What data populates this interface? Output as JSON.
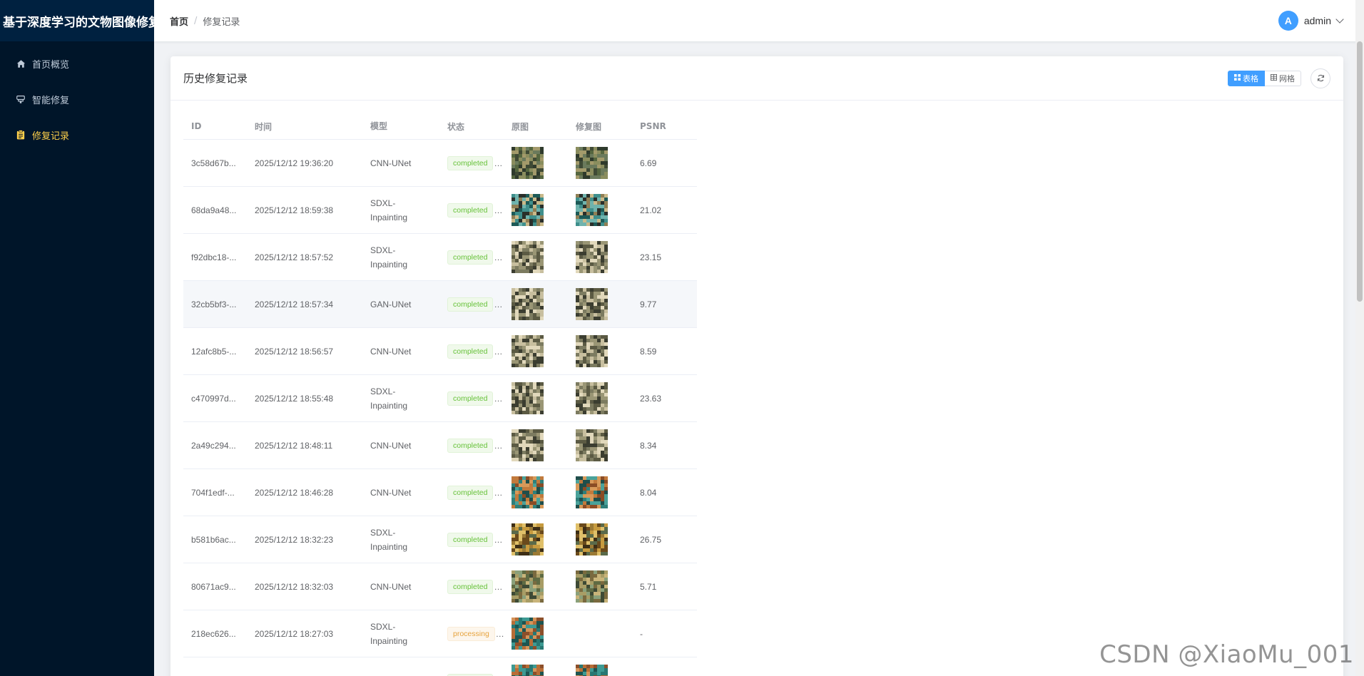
{
  "app": {
    "title": "基于深度学习的文物图像修复"
  },
  "sidebar": {
    "items": [
      {
        "label": "首页概览",
        "icon": "home-icon",
        "active": false
      },
      {
        "label": "智能修复",
        "icon": "brush-icon",
        "active": false
      },
      {
        "label": "修复记录",
        "icon": "clipboard-icon",
        "active": true
      }
    ]
  },
  "header": {
    "breadcrumb": {
      "home": "首页",
      "separator": "/",
      "current": "修复记录"
    },
    "user": {
      "avatar_letter": "A",
      "name": "admin"
    }
  },
  "card": {
    "title": "历史修复记录",
    "view_table_label": "表格",
    "view_grid_label": "网格",
    "refresh_icon": "refresh-icon"
  },
  "table": {
    "columns": [
      "ID",
      "时间",
      "模型",
      "状态",
      "原图",
      "修复图",
      "PSNR"
    ],
    "rows": [
      {
        "id": "3c58d67b...",
        "time": "2025/12/12 19:36:20",
        "model": [
          "CNN-UNet"
        ],
        "status": "completed",
        "psnr": "6.69",
        "theme": "dense",
        "restored": true
      },
      {
        "id": "68da9a48...",
        "time": "2025/12/12 18:59:38",
        "model": [
          "SDXL-",
          "Inpainting"
        ],
        "status": "completed",
        "psnr": "21.02",
        "theme": "teal",
        "restored": true
      },
      {
        "id": "f92dbc18-...",
        "time": "2025/12/12 18:57:52",
        "model": [
          "SDXL-",
          "Inpainting"
        ],
        "status": "completed",
        "psnr": "23.15",
        "theme": "pale",
        "restored": true
      },
      {
        "id": "32cb5bf3-...",
        "time": "2025/12/12 18:57:34",
        "model": [
          "GAN-UNet"
        ],
        "status": "completed",
        "psnr": "9.77",
        "theme": "pale",
        "restored": true
      },
      {
        "id": "12afc8b5-...",
        "time": "2025/12/12 18:56:57",
        "model": [
          "CNN-UNet"
        ],
        "status": "completed",
        "psnr": "8.59",
        "theme": "pale",
        "restored": true
      },
      {
        "id": "c470997d...",
        "time": "2025/12/12 18:55:48",
        "model": [
          "SDXL-",
          "Inpainting"
        ],
        "status": "completed",
        "psnr": "23.63",
        "theme": "pale",
        "restored": true
      },
      {
        "id": "2a49c294...",
        "time": "2025/12/12 18:48:11",
        "model": [
          "CNN-UNet"
        ],
        "status": "completed",
        "psnr": "8.34",
        "theme": "pale",
        "restored": true
      },
      {
        "id": "704f1edf-...",
        "time": "2025/12/12 18:46:28",
        "model": [
          "CNN-UNet"
        ],
        "status": "completed",
        "psnr": "8.04",
        "theme": "orange",
        "restored": true
      },
      {
        "id": "b581b6ac...",
        "time": "2025/12/12 18:32:23",
        "model": [
          "SDXL-",
          "Inpainting"
        ],
        "status": "completed",
        "psnr": "26.75",
        "theme": "gold",
        "restored": true
      },
      {
        "id": "80671ac9...",
        "time": "2025/12/12 18:32:03",
        "model": [
          "CNN-UNet"
        ],
        "status": "completed",
        "psnr": "5.71",
        "theme": "olive",
        "restored": true
      },
      {
        "id": "218ec626...",
        "time": "2025/12/12 18:27:03",
        "model": [
          "SDXL-",
          "Inpainting"
        ],
        "status": "processing",
        "psnr": "-",
        "theme": "tealorange",
        "restored": false
      },
      {
        "id": "",
        "time": "",
        "model": [
          ""
        ],
        "status": "completed",
        "psnr": "",
        "theme": "tealorange",
        "restored": true
      }
    ]
  },
  "colors": {
    "sidebar_bg": "#001529",
    "brand_bg": "#002140",
    "active_menu": "#ffd04b",
    "primary": "#409eff",
    "success": "#67c23a",
    "warning": "#e6a23c"
  },
  "watermark": "CSDN @XiaoMu_001"
}
